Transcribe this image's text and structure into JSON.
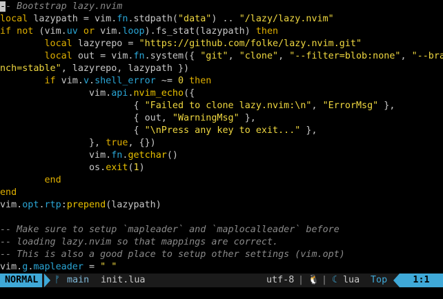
{
  "colors": {
    "background": "#000000",
    "keyword": "#e0b000",
    "string": "#f0d840",
    "function": "#e8c000",
    "member": "#2aa6d6",
    "comment": "#8a8a8a",
    "text": "#c8c8c8",
    "mode_accent": "#3fa9d8"
  },
  "code": {
    "lines": [
      [
        {
          "t": "-",
          "c": "cursor"
        },
        {
          "t": "- Bootstrap lazy.nvim",
          "c": "cm"
        }
      ],
      [
        {
          "t": "local",
          "c": "kw"
        },
        {
          "t": " lazypath = vim.",
          "c": "tx"
        },
        {
          "t": "fn",
          "c": "mem"
        },
        {
          "t": ".stdpath(",
          "c": "tx"
        },
        {
          "t": "\"data\"",
          "c": "str"
        },
        {
          "t": ") .. ",
          "c": "tx"
        },
        {
          "t": "\"/lazy/lazy.nvim\"",
          "c": "str"
        }
      ],
      [
        {
          "t": "if not",
          "c": "kw"
        },
        {
          "t": " (vim.",
          "c": "tx"
        },
        {
          "t": "uv",
          "c": "mem"
        },
        {
          "t": " or ",
          "c": "kw"
        },
        {
          "t": "vim.",
          "c": "tx"
        },
        {
          "t": "loop",
          "c": "mem"
        },
        {
          "t": ").fs_stat(lazypath) ",
          "c": "tx"
        },
        {
          "t": "then",
          "c": "kw"
        }
      ],
      [
        {
          "t": "        ",
          "c": "tx"
        },
        {
          "t": "local",
          "c": "kw"
        },
        {
          "t": " lazyrepo = ",
          "c": "tx"
        },
        {
          "t": "\"https://github.com/folke/lazy.nvim.git\"",
          "c": "str"
        }
      ],
      [
        {
          "t": "        ",
          "c": "tx"
        },
        {
          "t": "local",
          "c": "kw"
        },
        {
          "t": " out = vim.",
          "c": "tx"
        },
        {
          "t": "fn",
          "c": "mem"
        },
        {
          "t": ".system({ ",
          "c": "tx"
        },
        {
          "t": "\"git\"",
          "c": "str"
        },
        {
          "t": ", ",
          "c": "tx"
        },
        {
          "t": "\"clone\"",
          "c": "str"
        },
        {
          "t": ", ",
          "c": "tx"
        },
        {
          "t": "\"--filter=blob:none\"",
          "c": "str"
        },
        {
          "t": ", ",
          "c": "tx"
        },
        {
          "t": "\"--bra",
          "c": "str"
        }
      ],
      [
        {
          "t": "nch=stable\"",
          "c": "str"
        },
        {
          "t": ", lazyrepo, lazypath })",
          "c": "tx"
        }
      ],
      [
        {
          "t": "        ",
          "c": "tx"
        },
        {
          "t": "if",
          "c": "kw"
        },
        {
          "t": " vim.",
          "c": "tx"
        },
        {
          "t": "v",
          "c": "mem"
        },
        {
          "t": ".",
          "c": "tx"
        },
        {
          "t": "shell_error",
          "c": "mem"
        },
        {
          "t": " ~= ",
          "c": "tx"
        },
        {
          "t": "0",
          "c": "str"
        },
        {
          "t": " then",
          "c": "kw"
        }
      ],
      [
        {
          "t": "                vim.",
          "c": "tx"
        },
        {
          "t": "api",
          "c": "mem"
        },
        {
          "t": ".",
          "c": "tx"
        },
        {
          "t": "nvim_echo",
          "c": "fn"
        },
        {
          "t": "({",
          "c": "tx"
        }
      ],
      [
        {
          "t": "                        { ",
          "c": "tx"
        },
        {
          "t": "\"Failed to clone lazy.nvim:\\n\"",
          "c": "str"
        },
        {
          "t": ", ",
          "c": "tx"
        },
        {
          "t": "\"ErrorMsg\"",
          "c": "str"
        },
        {
          "t": " },",
          "c": "tx"
        }
      ],
      [
        {
          "t": "                        { out, ",
          "c": "tx"
        },
        {
          "t": "\"WarningMsg\"",
          "c": "str"
        },
        {
          "t": " },",
          "c": "tx"
        }
      ],
      [
        {
          "t": "                        { ",
          "c": "tx"
        },
        {
          "t": "\"\\nPress any key to exit...\"",
          "c": "str"
        },
        {
          "t": " },",
          "c": "tx"
        }
      ],
      [
        {
          "t": "                }, ",
          "c": "tx"
        },
        {
          "t": "true",
          "c": "kw"
        },
        {
          "t": ", {})",
          "c": "tx"
        }
      ],
      [
        {
          "t": "                vim.",
          "c": "tx"
        },
        {
          "t": "fn",
          "c": "mem"
        },
        {
          "t": ".",
          "c": "tx"
        },
        {
          "t": "getchar",
          "c": "fn"
        },
        {
          "t": "()",
          "c": "tx"
        }
      ],
      [
        {
          "t": "                os.",
          "c": "tx"
        },
        {
          "t": "exit",
          "c": "fn"
        },
        {
          "t": "(",
          "c": "tx"
        },
        {
          "t": "1",
          "c": "str"
        },
        {
          "t": ")",
          "c": "tx"
        }
      ],
      [
        {
          "t": "        ",
          "c": "tx"
        },
        {
          "t": "end",
          "c": "kw"
        }
      ],
      [
        {
          "t": "end",
          "c": "kw"
        }
      ],
      [
        {
          "t": "vim.",
          "c": "tx"
        },
        {
          "t": "opt",
          "c": "mem"
        },
        {
          "t": ".",
          "c": "tx"
        },
        {
          "t": "rtp",
          "c": "mem"
        },
        {
          "t": ":",
          "c": "tx"
        },
        {
          "t": "prepend",
          "c": "fn"
        },
        {
          "t": "(lazypath)",
          "c": "tx"
        }
      ],
      [],
      [
        {
          "t": "-- Make sure to setup `mapleader` and `maplocalleader` before",
          "c": "cm"
        }
      ],
      [
        {
          "t": "-- loading lazy.nvim so that mappings are correct.",
          "c": "cm"
        }
      ],
      [
        {
          "t": "-- This is also a good place to setup other settings (vim.opt)",
          "c": "cm"
        }
      ],
      [
        {
          "t": "vim.",
          "c": "tx"
        },
        {
          "t": "g",
          "c": "mem"
        },
        {
          "t": ".",
          "c": "tx"
        },
        {
          "t": "mapleader",
          "c": "mem"
        },
        {
          "t": " = ",
          "c": "tx"
        },
        {
          "t": "\" \"",
          "c": "str"
        }
      ]
    ]
  },
  "statusline": {
    "mode": "NORMAL",
    "branch_icon": "git-branch-icon",
    "branch_glyph": "ᚠ",
    "branch": "main",
    "filename": "init.lua",
    "encoding": "utf-8",
    "separator": "|",
    "os_icon": "linux-tux-icon",
    "os_glyph": "🐧",
    "filetype_icon": "lua-moon-icon",
    "filetype_glyph": "☾",
    "filetype": "lua",
    "position": "Top",
    "location": "1:1"
  }
}
